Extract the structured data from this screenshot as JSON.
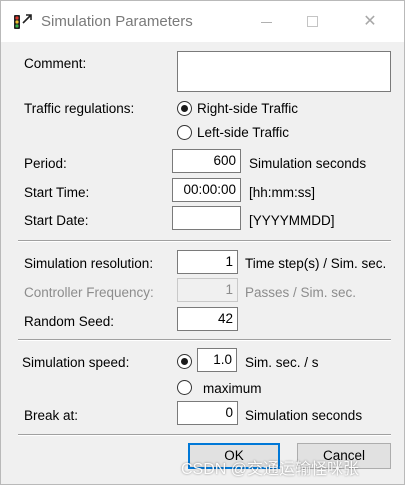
{
  "window": {
    "title": "Simulation Parameters",
    "icon": "traffic-light-icon"
  },
  "titlebar_buttons": {
    "minimize_icon": "minimize-icon",
    "maximize_icon": "maximize-icon",
    "close_glyph": "✕"
  },
  "comment": {
    "label": "Comment:",
    "value": ""
  },
  "traffic": {
    "label": "Traffic regulations:",
    "options": [
      "Right-side Traffic",
      "Left-side Traffic"
    ],
    "selected": "Right-side Traffic"
  },
  "period": {
    "label": "Period:",
    "value": "600",
    "unit": "Simulation seconds"
  },
  "start_time": {
    "label": "Start Time:",
    "value": "00:00:00",
    "format": "[hh:mm:ss]"
  },
  "start_date": {
    "label": "Start Date:",
    "value": "",
    "format": "[YYYYMMDD]"
  },
  "resolution": {
    "label": "Simulation resolution:",
    "value": "1",
    "unit": "Time step(s) / Sim. sec."
  },
  "controller_frequency": {
    "label": "Controller Frequency:",
    "value": "1",
    "unit": "Passes / Sim. sec.",
    "enabled": false
  },
  "random_seed": {
    "label": "Random Seed:",
    "value": "42"
  },
  "speed": {
    "label": "Simulation speed:",
    "value": "1.0",
    "unit": "Sim. sec. / s",
    "max_label": "maximum",
    "selected": "value"
  },
  "break_at": {
    "label": "Break at:",
    "value": "0",
    "unit": "Simulation seconds"
  },
  "buttons": {
    "ok": "OK",
    "cancel": "Cancel"
  },
  "watermark": "CSDN @交通运输怪咪张",
  "colors": {
    "default_button_border": "#0078d7",
    "window_bg": "#f0f0f0"
  }
}
